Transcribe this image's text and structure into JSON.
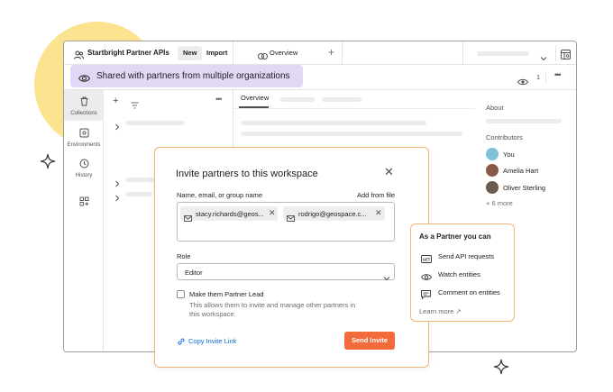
{
  "workspace": {
    "name": "Startbright Partner APIs",
    "new_label": "New",
    "import_label": "Import"
  },
  "tabs": [
    {
      "label": "Overview"
    }
  ],
  "banner": {
    "text": "Shared with partners from multiple organizations"
  },
  "watch": {
    "count": "1"
  },
  "nav": [
    {
      "label": "Collections",
      "icon": "trash-bin-icon"
    },
    {
      "label": "Environments",
      "icon": "environment-icon"
    },
    {
      "label": "History",
      "icon": "history-icon"
    }
  ],
  "overview": {
    "tab_label": "Overview"
  },
  "about": {
    "heading": "About",
    "contributors_heading": "Contributors",
    "contributors": [
      {
        "name": "You",
        "color": "#7fc1d6"
      },
      {
        "name": "Amelia Hart",
        "color": "#8a5a48"
      },
      {
        "name": "Oliver Sterling",
        "color": "#6b5a4e"
      }
    ],
    "more_link": "+ 6 more"
  },
  "invite_modal": {
    "title": "Invite partners to this workspace",
    "field_label": "Name, email, or group name",
    "add_from_file": "Add from file",
    "chips": [
      {
        "text": "stacy.richards@geos..."
      },
      {
        "text": "rodrigo@geospace.c..."
      }
    ],
    "role_label": "Role",
    "role_value": "Editor",
    "checkbox_label": "Make them Partner Lead",
    "checkbox_help": "This allows them to invite and manage other partners in this workspace.",
    "copy_link": "Copy Invite Link",
    "send_button": "Send Invite"
  },
  "partner_popover": {
    "title": "As a Partner you can",
    "items": [
      {
        "label": "Send API requests",
        "icon": "get-request-icon"
      },
      {
        "label": "Watch entities",
        "icon": "eye-icon"
      },
      {
        "label": "Comment on entities",
        "icon": "comment-icon"
      }
    ],
    "learn_more": "Learn more ↗"
  },
  "colors": {
    "accent": "#f26b3a",
    "highlight_border": "#f3b477",
    "banner_bg": "#e2d8f5",
    "link": "#0c6fd8",
    "blob": "#fbe38f"
  }
}
